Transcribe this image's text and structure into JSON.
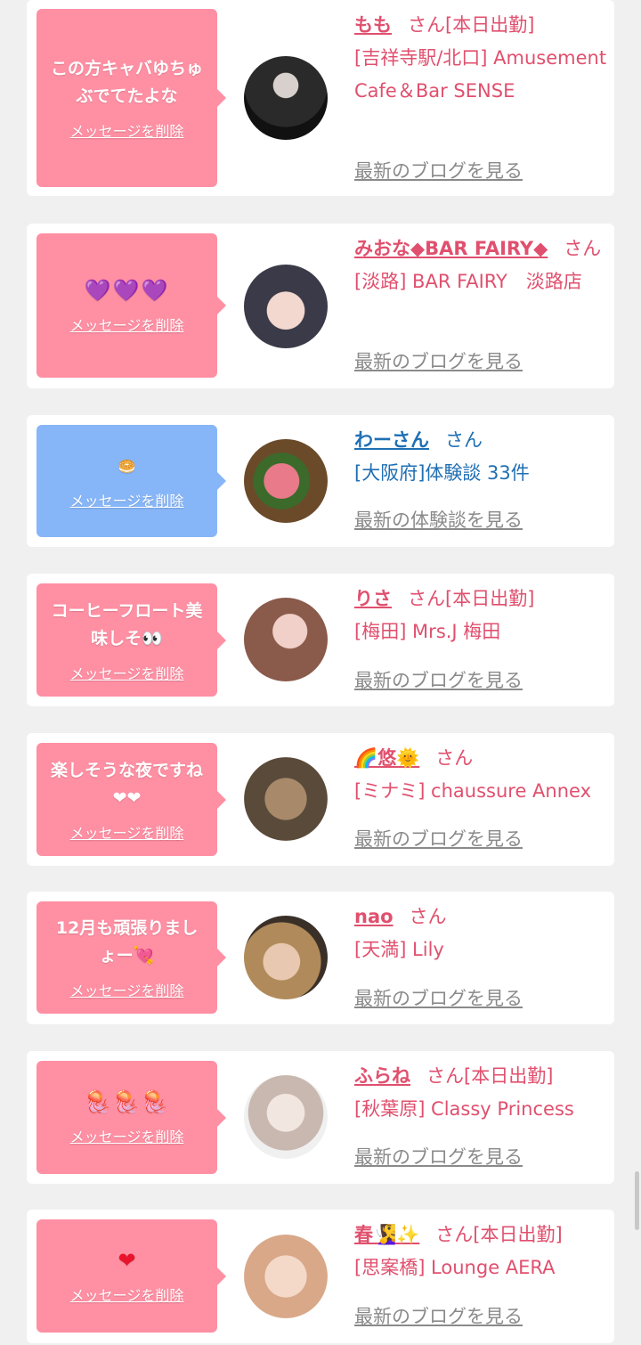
{
  "cards": [
    {
      "message": "この方キャバゆちゅぶでてたよな",
      "delete_label": "メッセージを削除",
      "name": "もも",
      "san": "さん[本日出勤]",
      "area": "[吉祥寺駅/北口] Amusement Cafe＆Bar SENSE",
      "latest": "最新のブログを見る",
      "bubble_color": "#ff8fa3",
      "text_color": "#e0506e"
    },
    {
      "message": "💜💜💜",
      "delete_label": "メッセージを削除",
      "name": "みおな◆BAR FAIRY◆",
      "san": "さん",
      "area": "[淡路] BAR FAIRY　淡路店",
      "latest": "最新のブログを見る",
      "bubble_color": "#ff8fa3",
      "text_color": "#e0506e"
    },
    {
      "message": "🥯",
      "delete_label": "メッセージを削除",
      "name": "わーさん",
      "san": "さん",
      "area": "[大阪府]体験談 33件",
      "latest": "最新の体験談を見る",
      "bubble_color": "#87b6f8",
      "text_color": "#1f6fb4"
    },
    {
      "message": "コーヒーフロート美味しそ👀",
      "delete_label": "メッセージを削除",
      "name": "りさ",
      "san": "さん[本日出勤]",
      "area": "[梅田] Mrs.J 梅田",
      "latest": "最新のブログを見る",
      "bubble_color": "#ff8fa3",
      "text_color": "#e0506e"
    },
    {
      "message": "楽しそうな夜ですね❤❤",
      "delete_label": "メッセージを削除",
      "name": "🌈悠🌞",
      "san": "さん",
      "area": "[ミナミ] chaussure Annex",
      "latest": "最新のブログを見る",
      "bubble_color": "#ff8fa3",
      "text_color": "#e0506e"
    },
    {
      "message": "12月も頑張りましょー💘",
      "delete_label": "メッセージを削除",
      "name": "nao",
      "san": "さん",
      "area": "[天満] Lily",
      "latest": "最新のブログを見る",
      "bubble_color": "#ff8fa3",
      "text_color": "#e0506e"
    },
    {
      "message": "🪼🪼🪼",
      "delete_label": "メッセージを削除",
      "name": "ふらね",
      "san": "さん[本日出勤]",
      "area": "[秋葉原] Classy Princess",
      "latest": "最新のブログを見る",
      "bubble_color": "#ff8fa3",
      "text_color": "#e0506e"
    },
    {
      "message": "❤",
      "delete_label": "メッセージを削除",
      "name": "春🧏‍♀️✨",
      "san": "さん[本日出勤]",
      "area": "[思案橋] Lounge AERA",
      "latest": "最新のブログを見る",
      "bubble_color": "#ff8fa3",
      "text_color": "#e0506e"
    }
  ]
}
